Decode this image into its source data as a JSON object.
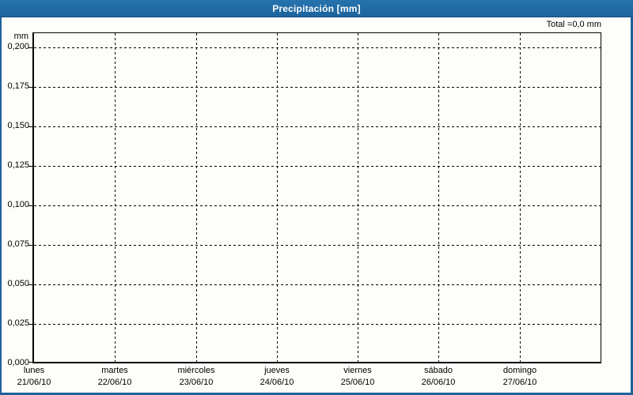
{
  "window": {
    "title": "Precipitación [mm]"
  },
  "colors": {
    "frame_blue": "#1e639c",
    "titlebar_blue": "#2070aa",
    "background": "#fdfefa",
    "grid": "#000000",
    "text": "#000000",
    "title_text": "#ffffff"
  },
  "chart_data": {
    "type": "bar",
    "title": "Precipitación [mm]",
    "total_label": "Total =0,0 mm",
    "total_value_mm": 0.0,
    "unit_label": "mm",
    "ylabel": "mm",
    "ylim": [
      0,
      0.21
    ],
    "ytick_step": 0.025,
    "ytick_labels": [
      "0,000",
      "0,025",
      "0,050",
      "0,075",
      "0,100",
      "0,125",
      "0,150",
      "0,175",
      "0,200"
    ],
    "x_categories": [
      {
        "weekday": "lunes",
        "date": "21/06/10"
      },
      {
        "weekday": "martes",
        "date": "22/06/10"
      },
      {
        "weekday": "miércoles",
        "date": "23/06/10"
      },
      {
        "weekday": "jueves",
        "date": "24/06/10"
      },
      {
        "weekday": "viernes",
        "date": "25/06/10"
      },
      {
        "weekday": "sábado",
        "date": "26/06/10"
      },
      {
        "weekday": "domingo",
        "date": "27/06/10"
      }
    ],
    "series": [
      {
        "name": "Precipitación",
        "values": [
          0,
          0,
          0,
          0,
          0,
          0,
          0
        ]
      }
    ],
    "grid": {
      "horizontal": true,
      "vertical": true,
      "style": "dashed"
    },
    "legend_position": "none"
  }
}
